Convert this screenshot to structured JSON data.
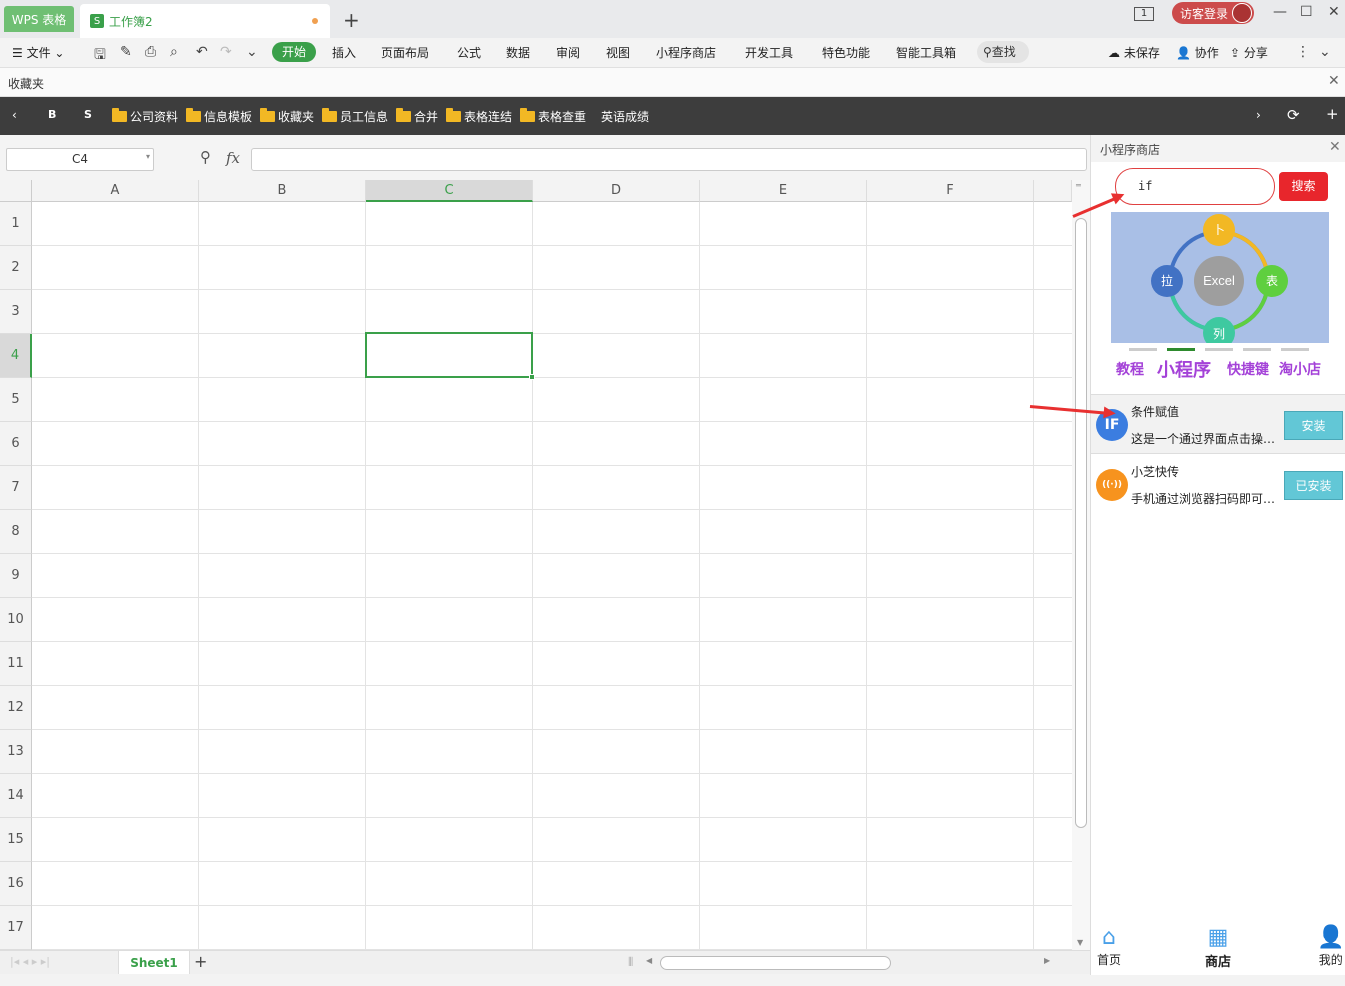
{
  "titlebar": {
    "app_tab": "WPS 表格",
    "doc_tab": "工作簿2",
    "doc_icon": "S",
    "window_num": "1",
    "login": "访客登录"
  },
  "menubar": {
    "file": "文件",
    "items": [
      "开始",
      "插入",
      "页面布局",
      "公式",
      "数据",
      "审阅",
      "视图",
      "小程序商店",
      "开发工具",
      "特色功能",
      "智能工具箱"
    ],
    "find": "查找",
    "unsaved": "未保存",
    "collab": "协作",
    "share": "分享"
  },
  "favbar": {
    "label": "收藏夹"
  },
  "bookmarks": {
    "items": [
      "B",
      "S",
      "公司资料",
      "信息模板",
      "收藏夹",
      "员工信息",
      "合并",
      "表格连结",
      "表格查重",
      "英语成绩"
    ]
  },
  "formula": {
    "cell_ref": "C4",
    "fx": "fx",
    "value": ""
  },
  "sheet": {
    "columns": [
      "A",
      "B",
      "C",
      "D",
      "E",
      "F"
    ],
    "rows": [
      "1",
      "2",
      "3",
      "4",
      "5",
      "6",
      "7",
      "8",
      "9",
      "10",
      "11",
      "12",
      "13",
      "14",
      "15",
      "16",
      "17"
    ],
    "selected_col": "C",
    "selected_row": "4",
    "tab": "Sheet1"
  },
  "panel": {
    "title": "小程序商店",
    "search_value": "if",
    "search_btn": "搜索",
    "banner": {
      "center": "Excel",
      "top": "卜",
      "left": "拉",
      "right": "表",
      "bottom": "列"
    },
    "categories": [
      "教程",
      "小程序",
      "快捷键",
      "淘小店"
    ],
    "apps": [
      {
        "icon": "IF",
        "name": "条件赋值",
        "desc": "这是一个通过界面点击操…",
        "button": "安装",
        "color": "#3b7de0"
      },
      {
        "icon": "((·))",
        "name": "小芝快传",
        "desc": "手机通过浏览器扫码即可…",
        "button": "已安装",
        "color": "#f7931e"
      }
    ],
    "nav": [
      "首页",
      "商店",
      "我的"
    ]
  },
  "colors": {
    "accent": "#3aa04a",
    "search_red": "#e8262c",
    "category_purple": "#a442d8"
  }
}
